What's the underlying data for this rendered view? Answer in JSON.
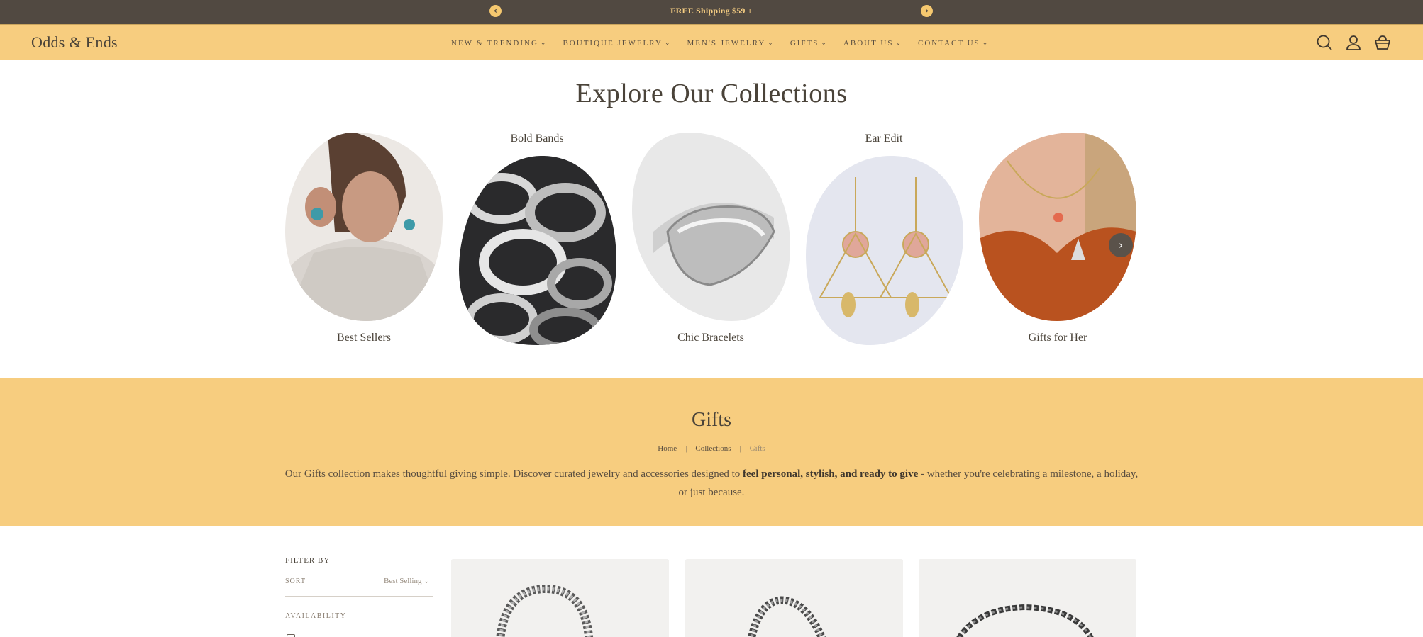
{
  "announcement": {
    "text": "FREE Shipping $59 +",
    "prev_icon": "chevron-left-icon",
    "next_icon": "chevron-right-icon"
  },
  "header": {
    "logo": "Odds & Ends",
    "nav": [
      {
        "label": "NEW & TRENDING"
      },
      {
        "label": "BOUTIQUE JEWELRY"
      },
      {
        "label": "MEN'S JEWELRY"
      },
      {
        "label": "GIFTS"
      },
      {
        "label": "ABOUT US"
      },
      {
        "label": "CONTACT US"
      }
    ],
    "icons": [
      "search-icon",
      "account-icon",
      "cart-icon"
    ]
  },
  "collections": {
    "title": "Explore Our Collections",
    "items": [
      {
        "label": "Best Sellers"
      },
      {
        "label": "Bold Bands"
      },
      {
        "label": "Chic Bracelets"
      },
      {
        "label": "Ear Edit"
      },
      {
        "label": "Gifts for Her"
      }
    ]
  },
  "gifts": {
    "title": "Gifts",
    "breadcrumb": [
      "Home",
      "Collections",
      "Gifts"
    ],
    "desc_before": "Our Gifts collection makes thoughtful giving simple. Discover curated jewelry and accessories designed to ",
    "desc_bold": "feel personal, stylish, and ready to give",
    "desc_after": " - whether you're celebrating a milestone, a holiday, or just because."
  },
  "filters": {
    "title": "FILTER BY",
    "sort_label": "SORT",
    "sort_value": "Best Selling",
    "availability": "AVAILABILITY"
  },
  "colors": {
    "announcement_bg": "#514941",
    "header_bg": "#f7cd7f",
    "text": "#4a4339"
  }
}
